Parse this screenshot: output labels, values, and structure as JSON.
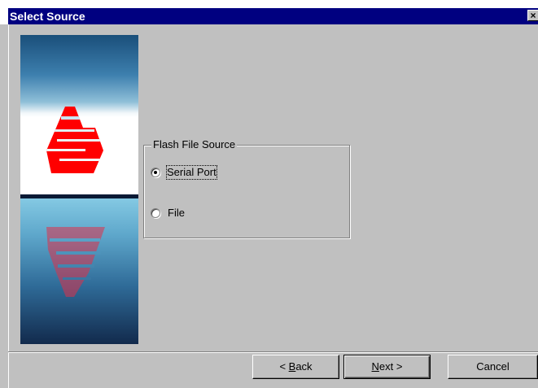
{
  "window": {
    "title": "Select Source",
    "close_glyph": "×"
  },
  "group": {
    "legend": "Flash File Source",
    "options": [
      {
        "label": "Serial Port",
        "checked": true
      },
      {
        "label": "File",
        "checked": false
      }
    ]
  },
  "buttons": {
    "back": {
      "mnemonic": "B",
      "rest": "ack",
      "prefix": "< "
    },
    "next": {
      "mnemonic": "N",
      "rest": "ext",
      "suffix": " >"
    },
    "cancel": "Cancel"
  },
  "colors": {
    "titlebar": "#000080",
    "dialog_bg": "#c0c0c0",
    "logo_red": "#ff0000"
  },
  "icons": {
    "banner": "sailboat-logo-reflection"
  }
}
